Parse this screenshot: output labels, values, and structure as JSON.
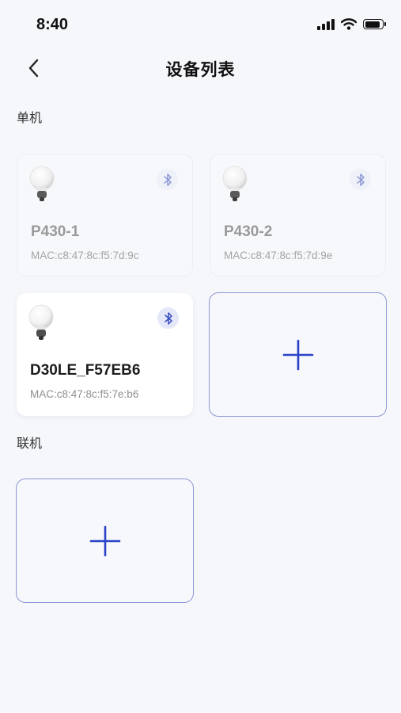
{
  "status_bar": {
    "time": "8:40",
    "battery_level_percent": 90,
    "icons": [
      "signal-icon",
      "wifi-icon",
      "battery-icon"
    ]
  },
  "nav": {
    "title": "设备列表",
    "back_icon": "chevron-left-icon"
  },
  "sections": {
    "standalone": {
      "label": "单机",
      "devices": [
        {
          "name": "P430-1",
          "mac": "MAC:c8:47:8c:f5:7d:9c",
          "online": false
        },
        {
          "name": "P430-2",
          "mac": "MAC:c8:47:8c:f5:7d:9e",
          "online": false
        },
        {
          "name": "D30LE_F57EB6",
          "mac": "MAC:c8:47:8c:f5:7e:b6",
          "online": true
        }
      ]
    },
    "networked": {
      "label": "联机"
    }
  },
  "colors": {
    "accent": "#2a43c6",
    "add_border": "#8e97d6",
    "background": "#f6f7fb"
  }
}
